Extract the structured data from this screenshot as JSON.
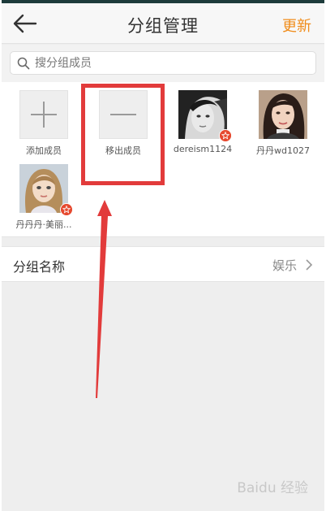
{
  "header": {
    "title": "分组管理",
    "update_label": "更新"
  },
  "search": {
    "placeholder": "搜分组成员"
  },
  "members": [
    {
      "label": "添加成员",
      "icon": "plus-icon"
    },
    {
      "label": "移出成员",
      "icon": "minus-icon"
    },
    {
      "label": "dereism1124",
      "icon": "avatar",
      "badge": "star-badge-icon"
    },
    {
      "label": "丹丹wd1027",
      "icon": "avatar"
    },
    {
      "label": "丹丹丹·美丽...",
      "icon": "avatar",
      "badge": "star-badge-icon"
    }
  ],
  "group_name": {
    "label": "分组名称",
    "value": "娱乐"
  },
  "watermark": "Baidu 经验",
  "colors": {
    "accent": "#f08c1a",
    "highlight": "#e23b3b",
    "badge": "#e6492f"
  }
}
